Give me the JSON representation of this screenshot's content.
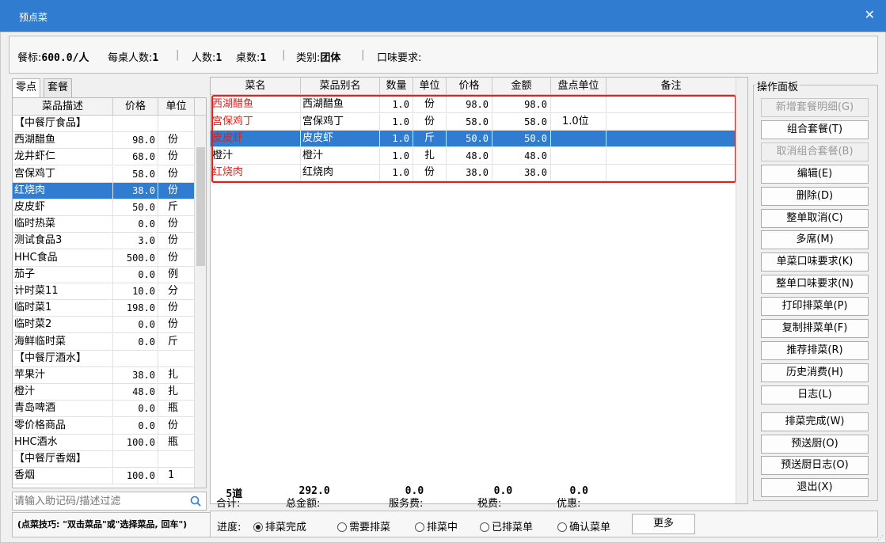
{
  "window": {
    "title": "预点菜",
    "close_glyph": "✕"
  },
  "info": {
    "standard_label": "餐标:",
    "standard_value": "600.0/人",
    "per_table_label": "每桌人数:",
    "per_table_value": "1",
    "people_label": "人数:",
    "people_value": "1",
    "tables_label": "桌数:",
    "tables_value": "1",
    "category_label": "类别:",
    "category_value": "团体",
    "taste_label": "口味要求:",
    "separator": "|"
  },
  "tabs": [
    {
      "label": "零点"
    },
    {
      "label": "套餐"
    }
  ],
  "menu": {
    "headers": [
      "菜品描述",
      "价格",
      "单位"
    ],
    "rows": [
      [
        "【中餐厅食品】",
        "",
        ""
      ],
      [
        "西湖醋鱼",
        "98.0",
        "份"
      ],
      [
        "龙井虾仁",
        "68.0",
        "份"
      ],
      [
        "宫保鸡丁",
        "58.0",
        "份"
      ],
      [
        "红烧肉",
        "38.0",
        "份"
      ],
      [
        "皮皮虾",
        "50.0",
        "斤"
      ],
      [
        "临时热菜",
        "0.0",
        "份"
      ],
      [
        "测试食品3",
        "3.0",
        "份"
      ],
      [
        "HHC食品",
        "500.0",
        "份"
      ],
      [
        "茄子",
        "0.0",
        "例"
      ],
      [
        "计时菜11",
        "10.0",
        "分"
      ],
      [
        "临时菜1",
        "198.0",
        "份"
      ],
      [
        "临时菜2",
        "0.0",
        "份"
      ],
      [
        "海鲜临时菜",
        "0.0",
        "斤"
      ],
      [
        "【中餐厅酒水】",
        "",
        ""
      ],
      [
        "苹果汁",
        "38.0",
        "扎"
      ],
      [
        "橙汁",
        "48.0",
        "扎"
      ],
      [
        "青岛啤酒",
        "0.0",
        "瓶"
      ],
      [
        "零价格商品",
        "0.0",
        "份"
      ],
      [
        "HHC酒水",
        "100.0",
        "瓶"
      ],
      [
        "【中餐厅香烟】",
        "",
        ""
      ],
      [
        "香烟",
        "100.0",
        "1"
      ]
    ],
    "selected_index": 4
  },
  "filter": {
    "placeholder": "请输入助记码/描述过滤",
    "icon": "search-icon"
  },
  "tip": "(点菜技巧: \"双击菜品\"或\"选择菜品, 回车\")",
  "order": {
    "headers": [
      "菜名",
      "菜品别名",
      "数量",
      "单位",
      "价格",
      "金额",
      "盘点单位",
      "备注"
    ],
    "rows": [
      [
        "西湖醋鱼",
        "西湖醋鱼",
        "1.0",
        "份",
        "98.0",
        "98.0",
        "",
        ""
      ],
      [
        "宫保鸡丁",
        "宫保鸡丁",
        "1.0",
        "份",
        "58.0",
        "58.0",
        "1.0位",
        ""
      ],
      [
        "皮皮虾",
        "皮皮虾",
        "1.0",
        "斤",
        "50.0",
        "50.0",
        "",
        ""
      ],
      [
        "橙汁",
        "橙汁",
        "1.0",
        "扎",
        "48.0",
        "48.0",
        "",
        ""
      ],
      [
        "红烧肉",
        "红烧肉",
        "1.0",
        "份",
        "38.0",
        "38.0",
        "",
        ""
      ]
    ],
    "red_rows": [
      0,
      1,
      2,
      4
    ],
    "selected_index": 2,
    "highlight_color": "#e0201b"
  },
  "totals": {
    "sum_label": "合计:",
    "sum_value": "5道",
    "amount_label": "总金额:",
    "amount_value": "292.0",
    "service_label": "服务费:",
    "service_value": "0.0",
    "tax_label": "税费:",
    "tax_value": "0.0",
    "discount_label": "优惠:",
    "discount_value": "0.0"
  },
  "progress": {
    "label": "进度:",
    "options": [
      "排菜完成",
      "需要排菜",
      "排菜中",
      "已排菜单",
      "确认菜单"
    ],
    "selected": 0,
    "more_label": "更多"
  },
  "ops": {
    "legend": "操作面板",
    "buttons": [
      {
        "label": "新增套餐明细(G)",
        "disabled": true
      },
      {
        "label": "组合套餐(T)",
        "disabled": false
      },
      {
        "label": "取消组合套餐(B)",
        "disabled": true
      },
      {
        "label": "编辑(E)",
        "disabled": false
      },
      {
        "label": "删除(D)",
        "disabled": false
      },
      {
        "label": "整单取消(C)",
        "disabled": false
      },
      {
        "label": "多席(M)",
        "disabled": false
      },
      {
        "label": "单菜口味要求(K)",
        "disabled": false
      },
      {
        "label": "整单口味要求(N)",
        "disabled": false
      },
      {
        "label": "打印排菜单(P)",
        "disabled": false
      },
      {
        "label": "复制排菜单(F)",
        "disabled": false
      },
      {
        "label": "推荐排菜(R)",
        "disabled": false
      },
      {
        "label": "历史消费(H)",
        "disabled": false
      },
      {
        "label": "日志(L)",
        "disabled": false
      },
      {
        "label": "排菜完成(W)",
        "disabled": false
      },
      {
        "label": "预送厨(O)",
        "disabled": false
      },
      {
        "label": "预送厨日志(O)",
        "disabled": false
      },
      {
        "label": "退出(X)",
        "disabled": false
      }
    ]
  },
  "colors": {
    "accent": "#2f7cd0",
    "red_text": "#e0201b"
  }
}
